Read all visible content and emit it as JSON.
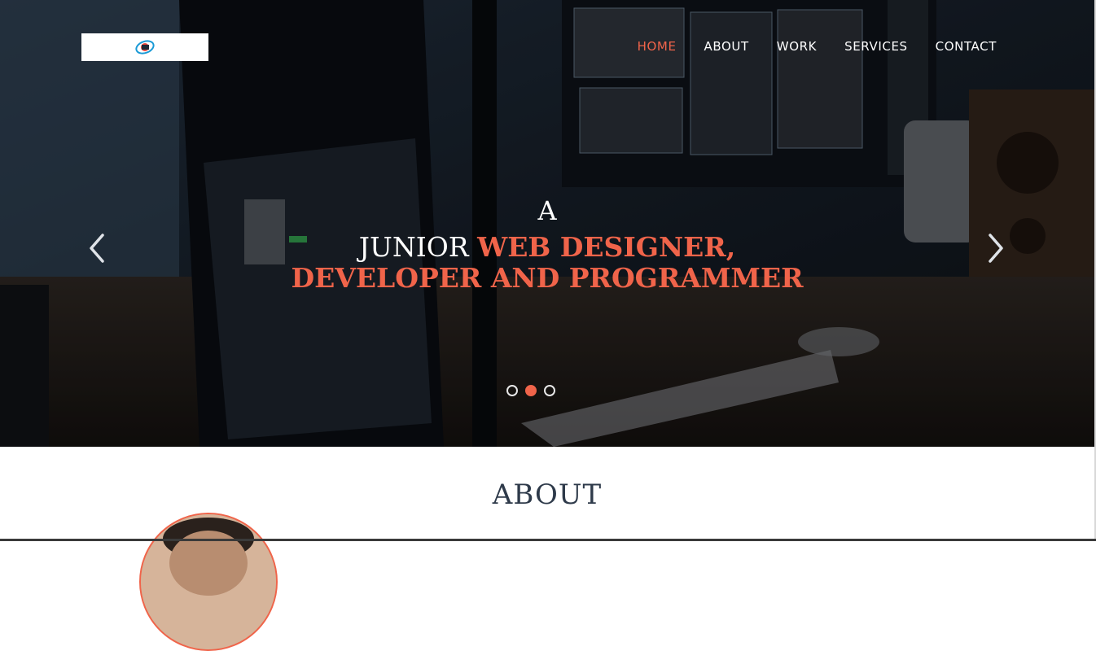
{
  "nav": {
    "items": [
      {
        "label": "HOME",
        "active": true
      },
      {
        "label": "ABOUT",
        "active": false
      },
      {
        "label": "WORK",
        "active": false
      },
      {
        "label": "SERVICES",
        "active": false
      },
      {
        "label": "CONTACT",
        "active": false
      }
    ]
  },
  "hero": {
    "line1": "A",
    "line2_plain": "JUNIOR ",
    "line2_accent": "WEB DESIGNER,",
    "line3_accent": "DEVELOPER AND PROGRAMMER",
    "carousel": {
      "slide_count": 3,
      "active_slide": 2,
      "prev_icon": "chevron-left-icon",
      "next_icon": "chevron-right-icon"
    }
  },
  "about": {
    "title": "ABOUT"
  },
  "colors": {
    "accent": "#f0644a",
    "text_dark": "#2e3a4a",
    "nav_text": "#ffffff"
  }
}
